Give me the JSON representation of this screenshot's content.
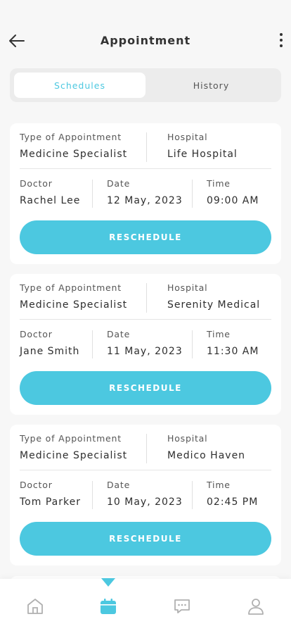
{
  "header": {
    "title": "Appointment",
    "back_icon": "arrow-left-icon",
    "more_icon": "more-vertical-icon"
  },
  "tabs": [
    {
      "label": "Schedules",
      "active": true
    },
    {
      "label": "History",
      "active": false
    }
  ],
  "labels": {
    "type": "Type of Appointment",
    "hospital": "Hospital",
    "doctor": "Doctor",
    "date": "Date",
    "time": "Time",
    "button": "RESCHEDULE"
  },
  "appointments": [
    {
      "type": "Medicine Specialist",
      "hospital": "Life Hospital",
      "doctor": "Rachel Lee",
      "date": "12 May, 2023",
      "time": "09:00 AM"
    },
    {
      "type": "Medicine Specialist",
      "hospital": "Serenity Medical",
      "doctor": "Jane Smith",
      "date": "11 May, 2023",
      "time": "11:30 AM"
    },
    {
      "type": "Medicine Specialist",
      "hospital": "Medico Haven",
      "doctor": "Tom Parker",
      "date": "10 May, 2023",
      "time": "02:45 PM"
    }
  ],
  "nav": [
    {
      "icon": "home-icon",
      "active": false
    },
    {
      "icon": "calendar-icon",
      "active": true
    },
    {
      "icon": "chat-icon",
      "active": false
    },
    {
      "icon": "profile-icon",
      "active": false
    }
  ],
  "colors": {
    "accent": "#4cc8e0",
    "text": "#2e2e2e",
    "inactive_icon": "#b0b0b0"
  }
}
